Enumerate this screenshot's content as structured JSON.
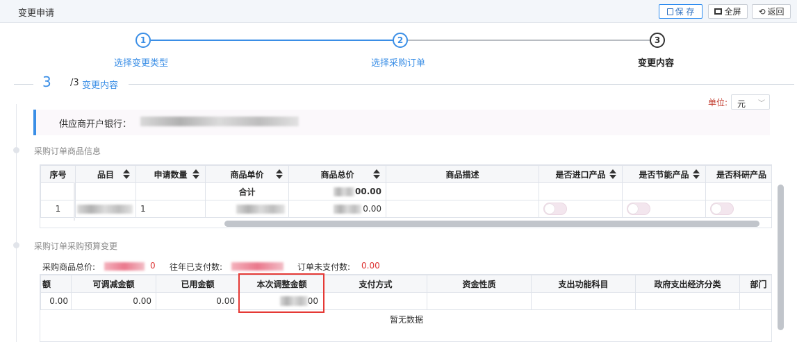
{
  "header": {
    "title": "变更申请",
    "save_label": "保 存",
    "fullscreen_label": "全屏",
    "back_label": "返回"
  },
  "stepper": {
    "steps": [
      {
        "num": "1",
        "label": "选择变更类型"
      },
      {
        "num": "2",
        "label": "选择采购订单"
      },
      {
        "num": "3",
        "label": "变更内容"
      }
    ]
  },
  "section": {
    "step": "3",
    "total": "/3",
    "name": "变更内容"
  },
  "unit": {
    "label": "单位:",
    "value": "元"
  },
  "bank": {
    "label": "供应商开户银行："
  },
  "goods": {
    "title": "采购订单商品信息",
    "columns": [
      "序号",
      "品目",
      "申请数量",
      "商品单价",
      "商品总价",
      "商品描述",
      "是否进口产品",
      "是否节能产品",
      "是否科研产品"
    ],
    "total_label": "合计",
    "total_value": "00.00",
    "row": {
      "index": "1",
      "qty": "1",
      "total": "0.00"
    }
  },
  "budget": {
    "title": "采购订单采购预算变更",
    "summary": {
      "total_label": "采购商品总价:",
      "total_tail": "0",
      "paid_label": "往年已支付数:",
      "unpaid_label": "订单未支付数:",
      "unpaid_value": "0.00"
    },
    "columns": [
      "额",
      "可调减金额",
      "已用金额",
      "本次调整金额",
      "支付方式",
      "资金性质",
      "支出功能科目",
      "政府支出经济分类",
      "部门"
    ],
    "row": [
      "0.00",
      "0.00",
      "0.00",
      "00"
    ],
    "empty_text": "暂无数据"
  }
}
